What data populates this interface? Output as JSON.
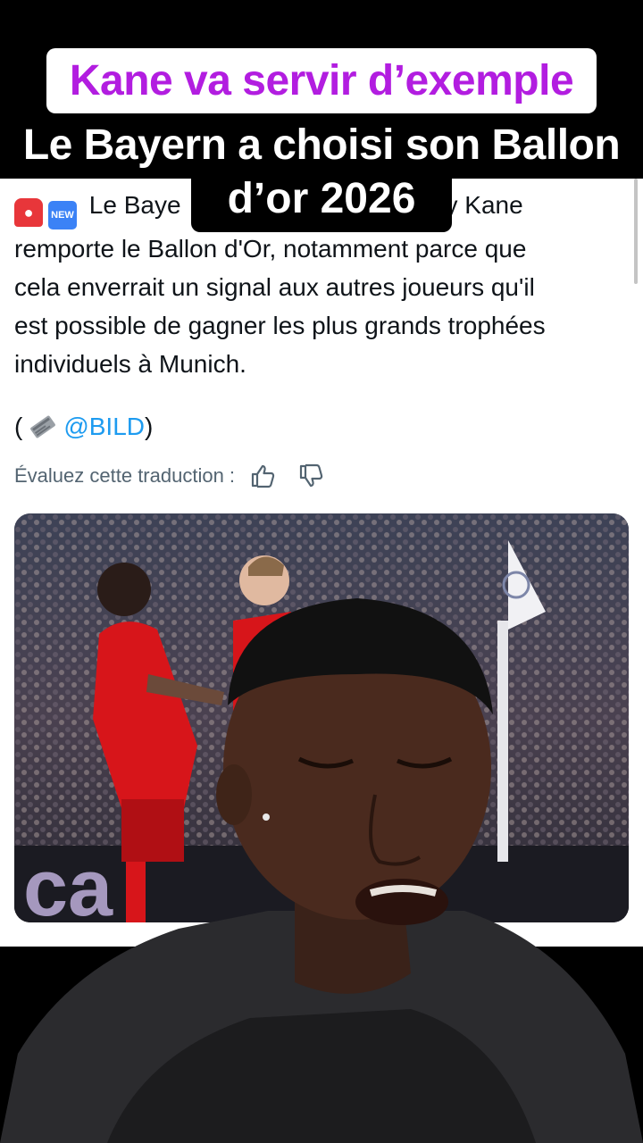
{
  "caption": {
    "line1": "Kane va servir d’exemple",
    "line2": "Le Bayern a choisi son Ballon",
    "line3": "d’or 2026"
  },
  "tweet": {
    "emoji1": "siren-emoji",
    "emoji2_label": "NEW",
    "text_line1_start": "Le Baye",
    "text_line1_end": "y Kane",
    "text_line2": "remporte le Ballon d'Or, notamment parce que",
    "text_line3": "cela enverrait un signal aux autres joueurs qu'il",
    "text_line4": "est possible de gagner les plus grands trophées",
    "text_line5": "individuels à Munich.",
    "source_open": "(",
    "source_icon": "newspaper-emoji",
    "source_mention": "@BILD",
    "source_close": ")",
    "rate_label": "Évaluez cette traduction :",
    "thumb_up_icon": "thumbs-up-icon",
    "thumb_down_icon": "thumbs-down-icon"
  },
  "photo": {
    "description_icon": "football-celebration-photo"
  },
  "colors": {
    "caption_pink": "#b21de0",
    "mention_blue": "#1d9bf0",
    "muted_text": "#536471",
    "bayern_red": "#d7151a"
  }
}
